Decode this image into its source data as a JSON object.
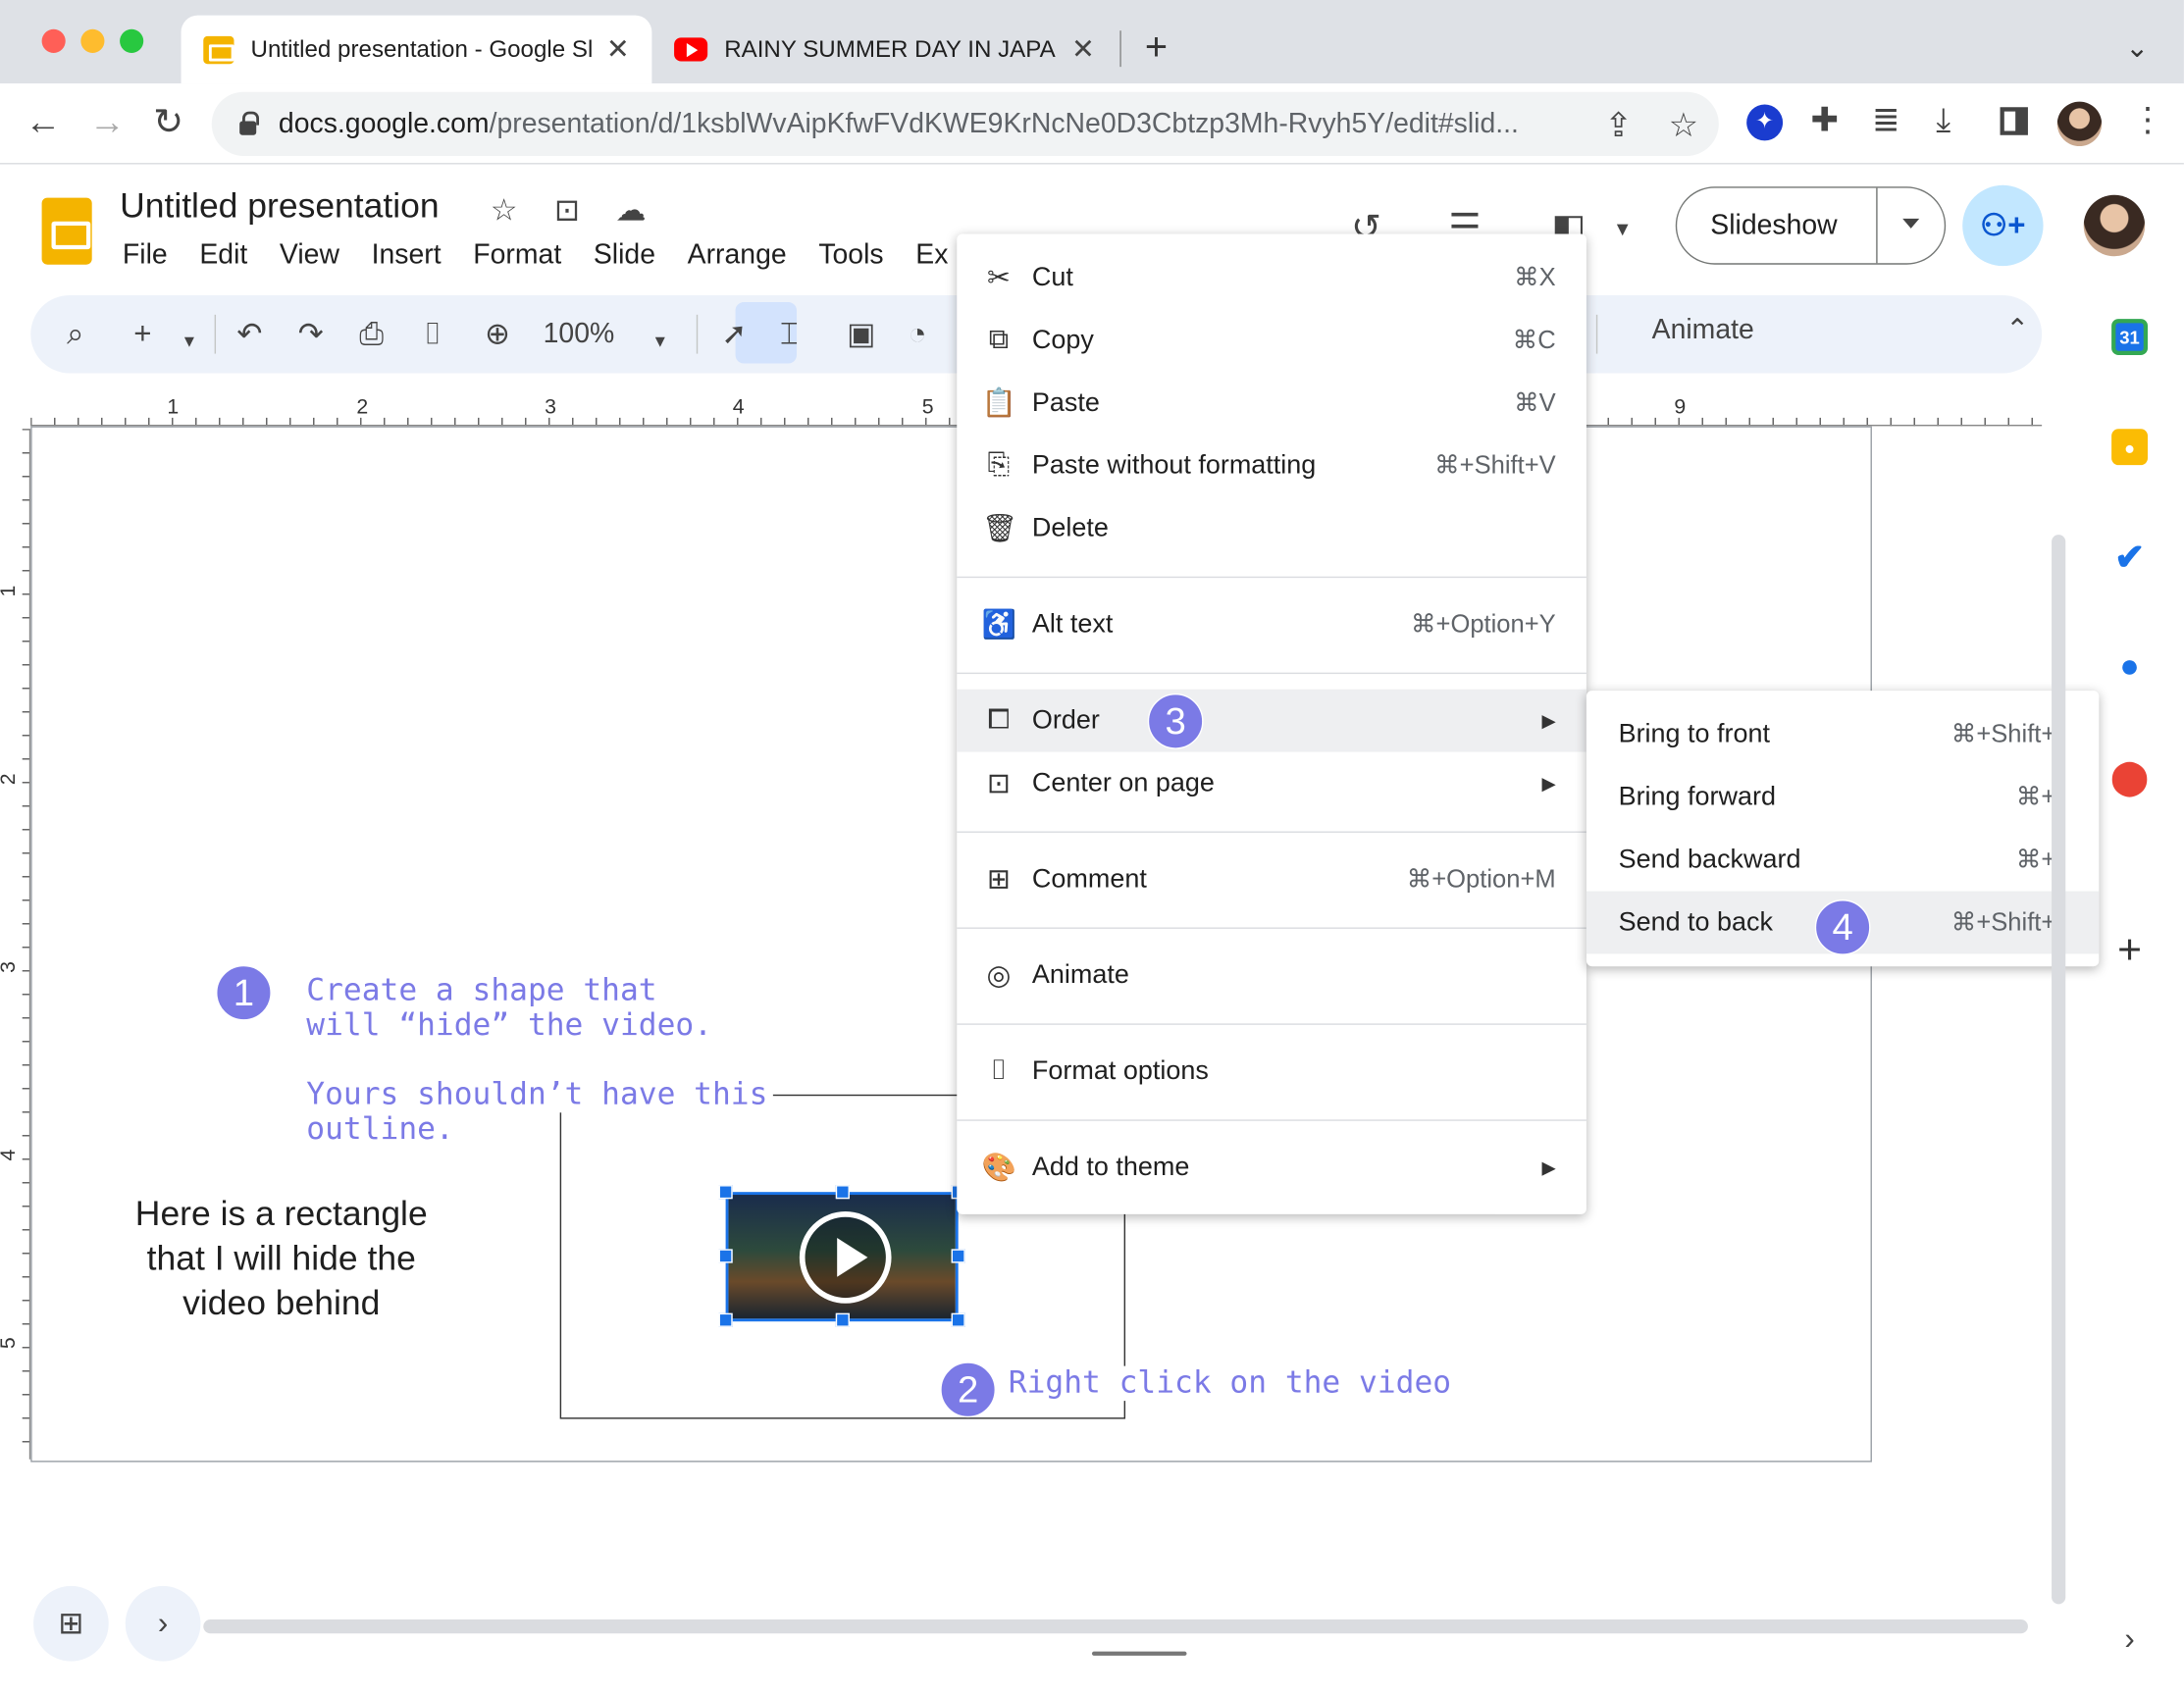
{
  "browser": {
    "tabs": [
      {
        "title": "Untitled presentation - Google Slides",
        "active": true
      },
      {
        "title": "RAINY SUMMER DAY IN JAPAN",
        "active": false
      }
    ],
    "url_host": "docs.google.com",
    "url_path": "/presentation/d/1ksblWvAipKfwFVdKWE9KrNcNe0D3Cbtzp3Mh-Rvyh5Y/edit#slid..."
  },
  "app": {
    "title": "Untitled presentation",
    "menu": [
      "File",
      "Edit",
      "View",
      "Insert",
      "Format",
      "Slide",
      "Arrange",
      "Tools",
      "Ex"
    ],
    "slideshow_label": "Slideshow",
    "zoom": "100%",
    "animate_label": "Animate"
  },
  "ruler": {
    "h_ticks": [
      "1",
      "2",
      "3",
      "4",
      "5",
      "9"
    ],
    "v_ticks": [
      "1",
      "2",
      "3",
      "4",
      "5"
    ]
  },
  "slide": {
    "caption": "Here is a rectangle that I will hide the video behind"
  },
  "annotations": {
    "step1_badge": "1",
    "step1_line1": "Create a shape that",
    "step1_line2": "will “hide” the video.",
    "step1_line3": "Yours shouldn’t have this",
    "step1_line4": "outline.",
    "step2_badge": "2",
    "step2_text": "Right click on the video",
    "step3_badge": "3",
    "step4_badge": "4"
  },
  "context_menu": {
    "items": [
      {
        "label": "Cut",
        "shortcut": "⌘X",
        "icon": "scissors-icon"
      },
      {
        "label": "Copy",
        "shortcut": "⌘C",
        "icon": "copy-icon"
      },
      {
        "label": "Paste",
        "shortcut": "⌘V",
        "icon": "clipboard-icon"
      },
      {
        "label": "Paste without formatting",
        "shortcut": "⌘+Shift+V",
        "icon": "clipboard-plain-icon"
      },
      {
        "label": "Delete",
        "shortcut": "",
        "icon": "trash-icon"
      },
      {
        "label": "Alt text",
        "shortcut": "⌘+Option+Y",
        "icon": "accessibility-icon"
      },
      {
        "label": "Order",
        "shortcut": "",
        "icon": "order-icon",
        "highlighted": true
      },
      {
        "label": "Center on page",
        "shortcut": "",
        "icon": "center-icon"
      },
      {
        "label": "Comment",
        "shortcut": "⌘+Option+M",
        "icon": "comment-icon"
      },
      {
        "label": "Animate",
        "shortcut": "",
        "icon": "animate-icon"
      },
      {
        "label": "Format options",
        "shortcut": "",
        "icon": "paint-roller-icon"
      },
      {
        "label": "Add to theme",
        "shortcut": "",
        "icon": "palette-icon"
      }
    ]
  },
  "order_submenu": {
    "items": [
      {
        "label": "Bring to front",
        "shortcut": "⌘+Shift+↑"
      },
      {
        "label": "Bring forward",
        "shortcut": "⌘+↑"
      },
      {
        "label": "Send backward",
        "shortcut": "⌘+↓"
      },
      {
        "label": "Send to back",
        "shortcut": "⌘+Shift+↓",
        "highlighted": true
      }
    ]
  },
  "side_panel": {
    "calendar_date": "31"
  },
  "colors": {
    "accent": "#7b7ae6",
    "selection": "#1a73e8",
    "slides_yellow": "#f4b400"
  }
}
